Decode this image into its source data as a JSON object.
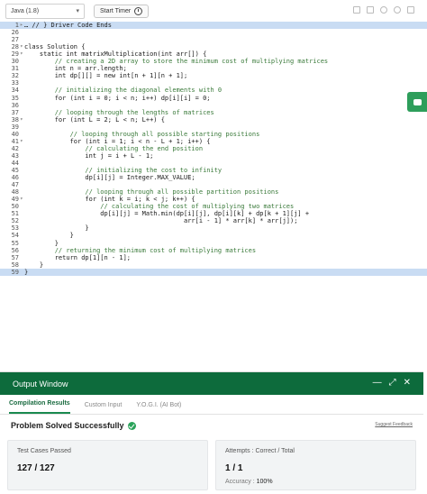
{
  "toolbar": {
    "language": "Java (1.8)",
    "start_timer": "Start Timer"
  },
  "editor": {
    "lines": [
      {
        "num": "1",
        "fold": "▸",
        "code": "… // } Driver Code Ends",
        "hl": true
      },
      {
        "num": "26",
        "fold": "",
        "code": "",
        "hl": false
      },
      {
        "num": "27",
        "fold": "",
        "code": "",
        "hl": false
      },
      {
        "num": "28",
        "fold": "▾",
        "code": "class Solution {",
        "hl": false
      },
      {
        "num": "29",
        "fold": "▾",
        "code": "    static int matrixMultiplication(int arr[]) {",
        "hl": false
      },
      {
        "num": "30",
        "fold": "",
        "code": "        // creating a 2D array to store the minimum cost of multiplying matrices",
        "hl": false,
        "comment": true
      },
      {
        "num": "31",
        "fold": "",
        "code": "        int n = arr.length;",
        "hl": false
      },
      {
        "num": "32",
        "fold": "",
        "code": "        int dp[][] = new int[n + 1][n + 1];",
        "hl": false
      },
      {
        "num": "33",
        "fold": "",
        "code": "",
        "hl": false
      },
      {
        "num": "34",
        "fold": "",
        "code": "        // initializing the diagonal elements with 0",
        "hl": false,
        "comment": true
      },
      {
        "num": "35",
        "fold": "",
        "code": "        for (int i = 0; i < n; i++) dp[i][i] = 0;",
        "hl": false
      },
      {
        "num": "36",
        "fold": "",
        "code": "",
        "hl": false
      },
      {
        "num": "37",
        "fold": "",
        "code": "        // looping through the lengths of matrices",
        "hl": false,
        "comment": true
      },
      {
        "num": "38",
        "fold": "▾",
        "code": "        for (int L = 2; L < n; L++) {",
        "hl": false
      },
      {
        "num": "39",
        "fold": "",
        "code": "",
        "hl": false
      },
      {
        "num": "40",
        "fold": "",
        "code": "            // looping through all possible starting positions",
        "hl": false,
        "comment": true
      },
      {
        "num": "41",
        "fold": "▾",
        "code": "            for (int i = 1; i < n - L + 1; i++) {",
        "hl": false
      },
      {
        "num": "42",
        "fold": "",
        "code": "                // calculating the end position",
        "hl": false,
        "comment": true
      },
      {
        "num": "43",
        "fold": "",
        "code": "                int j = i + L - 1;",
        "hl": false
      },
      {
        "num": "44",
        "fold": "",
        "code": "",
        "hl": false
      },
      {
        "num": "45",
        "fold": "",
        "code": "                // initializing the cost to infinity",
        "hl": false,
        "comment": true
      },
      {
        "num": "46",
        "fold": "",
        "code": "                dp[i][j] = Integer.MAX_VALUE;",
        "hl": false
      },
      {
        "num": "47",
        "fold": "",
        "code": "",
        "hl": false
      },
      {
        "num": "48",
        "fold": "",
        "code": "                // looping through all possible partition positions",
        "hl": false,
        "comment": true
      },
      {
        "num": "49",
        "fold": "▾",
        "code": "                for (int k = i; k < j; k++) {",
        "hl": false
      },
      {
        "num": "50",
        "fold": "",
        "code": "                    // calculating the cost of multiplying two matrices",
        "hl": false,
        "comment": true
      },
      {
        "num": "51",
        "fold": "",
        "code": "                    dp[i][j] = Math.min(dp[i][j], dp[i][k] + dp[k + 1][j] +",
        "hl": false
      },
      {
        "num": "52",
        "fold": "",
        "code": "                                          arr[i - 1] * arr[k] * arr[j]);",
        "hl": false
      },
      {
        "num": "53",
        "fold": "",
        "code": "                }",
        "hl": false
      },
      {
        "num": "54",
        "fold": "",
        "code": "            }",
        "hl": false
      },
      {
        "num": "55",
        "fold": "",
        "code": "        }",
        "hl": false
      },
      {
        "num": "56",
        "fold": "",
        "code": "        // returning the minimum cost of multiplying matrices",
        "hl": false,
        "comment": true
      },
      {
        "num": "57",
        "fold": "",
        "code": "        return dp[1][n - 1];",
        "hl": false
      },
      {
        "num": "58",
        "fold": "",
        "code": "    }",
        "hl": false
      },
      {
        "num": "59",
        "fold": "",
        "code": "}",
        "hl": true
      }
    ]
  },
  "output": {
    "title": "Output Window",
    "tabs": [
      "Compilation Results",
      "Custom Input",
      "Y.O.G.I. (AI Bot)"
    ],
    "result_title": "Problem Solved Successfully",
    "suggest_feedback": "Suggest Feedback",
    "test_cases_label": "Test Cases Passed",
    "test_cases_value": "127 / 127",
    "attempts_label": "Attempts : Correct / Total",
    "attempts_value": "1 / 1",
    "accuracy_label": "Accuracy :",
    "accuracy_value": "100%"
  },
  "colors": {
    "header_green": "#0d6b3c",
    "success_green": "#2aa35a",
    "highlight_blue": "#c9dcf3"
  }
}
